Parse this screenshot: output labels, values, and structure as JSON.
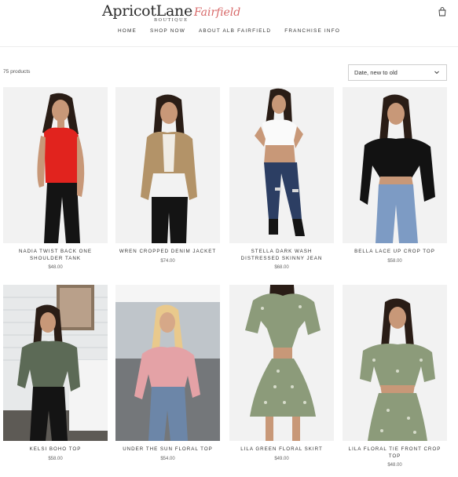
{
  "brand": {
    "name": "ApricotLane",
    "tagline": "BOUTIQUE",
    "location": "Fairfield"
  },
  "nav": [
    "HOME",
    "SHOP NOW",
    "ABOUT ALB FAIRFIELD",
    "FRANCHISE INFO"
  ],
  "icons": {
    "cart": "cart-icon",
    "sort_arrow": "chevron-down-icon"
  },
  "collection": {
    "count_label": "75 products",
    "sort_value": "Date, new to old"
  },
  "products": [
    {
      "title": "NADIA TWIST BACK ONE SHOULDER TANK",
      "price": "$48.00"
    },
    {
      "title": "WREN CROPPED DENIM JACKET",
      "price": "$74.00"
    },
    {
      "title": "STELLA DARK WASH DISTRESSED SKINNY JEAN",
      "price": "$68.00"
    },
    {
      "title": "BELLA LACE UP CROP TOP",
      "price": "$58.00"
    },
    {
      "title": "KELSI BOHO TOP",
      "price": "$58.00"
    },
    {
      "title": "UNDER THE SUN FLORAL TOP",
      "price": "$54.00"
    },
    {
      "title": "LILA GREEN FLORAL SKIRT",
      "price": "$49.00"
    },
    {
      "title": "LILA FLORAL TIE FRONT CROP TOP",
      "price": "$48.00"
    }
  ]
}
